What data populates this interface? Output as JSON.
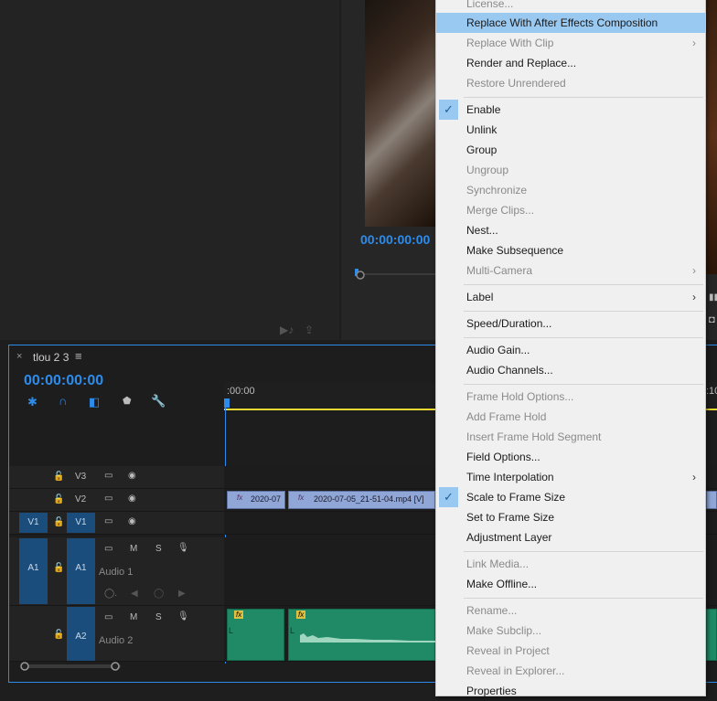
{
  "source_monitor": {
    "icons": [
      "insert-icon",
      "export-frame-icon"
    ]
  },
  "program_monitor": {
    "timecode": "00:00:00:00"
  },
  "timeline": {
    "close": "×",
    "sequence_name": "tlou 2 3",
    "menu_icon": "≡",
    "timecode": "00:00:00:00",
    "ruler_start": ":00:00",
    "ruler_end": ":10",
    "tracks": {
      "v3": {
        "label": "V3"
      },
      "v2": {
        "label": "V2"
      },
      "v1": {
        "source": "V1",
        "label": "V1"
      },
      "a1": {
        "source": "A1",
        "label": "A1",
        "name": "Audio 1",
        "m": "M",
        "s": "S"
      },
      "a2": {
        "label": "A2",
        "name": "Audio 2",
        "m": "M",
        "s": "S"
      }
    },
    "clips": {
      "v2_clip1": "2020-07",
      "v2_clip2": "2020-07-05_21-51-04.mp4 [V]",
      "fx": "fx",
      "audio_marker": "L"
    }
  },
  "context_menu": {
    "items": [
      {
        "label": "License...",
        "disabled": true
      },
      {
        "label": "Replace With After Effects Composition",
        "highlighted": true
      },
      {
        "label": "Replace With Clip",
        "disabled": true,
        "submenu": true
      },
      {
        "label": "Render and Replace..."
      },
      {
        "label": "Restore Unrendered",
        "disabled": true
      },
      {
        "label": "Enable",
        "checked": true
      },
      {
        "label": "Unlink"
      },
      {
        "label": "Group"
      },
      {
        "label": "Ungroup",
        "disabled": true
      },
      {
        "label": "Synchronize",
        "disabled": true
      },
      {
        "label": "Merge Clips...",
        "disabled": true
      },
      {
        "label": "Nest..."
      },
      {
        "label": "Make Subsequence"
      },
      {
        "label": "Multi-Camera",
        "disabled": true,
        "submenu": true
      },
      {
        "label": "Label",
        "submenu": true
      },
      {
        "label": "Speed/Duration..."
      },
      {
        "label": "Audio Gain..."
      },
      {
        "label": "Audio Channels..."
      },
      {
        "label": "Frame Hold Options...",
        "disabled": true
      },
      {
        "label": "Add Frame Hold",
        "disabled": true
      },
      {
        "label": "Insert Frame Hold Segment",
        "disabled": true
      },
      {
        "label": "Field Options..."
      },
      {
        "label": "Time Interpolation",
        "submenu": true
      },
      {
        "label": "Scale to Frame Size",
        "checked": true
      },
      {
        "label": "Set to Frame Size"
      },
      {
        "label": "Adjustment Layer"
      },
      {
        "label": "Link Media...",
        "disabled": true
      },
      {
        "label": "Make Offline..."
      },
      {
        "label": "Rename...",
        "disabled": true
      },
      {
        "label": "Make Subclip...",
        "disabled": true
      },
      {
        "label": "Reveal in Project",
        "disabled": true
      },
      {
        "label": "Reveal in Explorer...",
        "disabled": true
      },
      {
        "label": "Properties"
      }
    ],
    "submenu_arrow": "›",
    "check_mark": "✓"
  }
}
